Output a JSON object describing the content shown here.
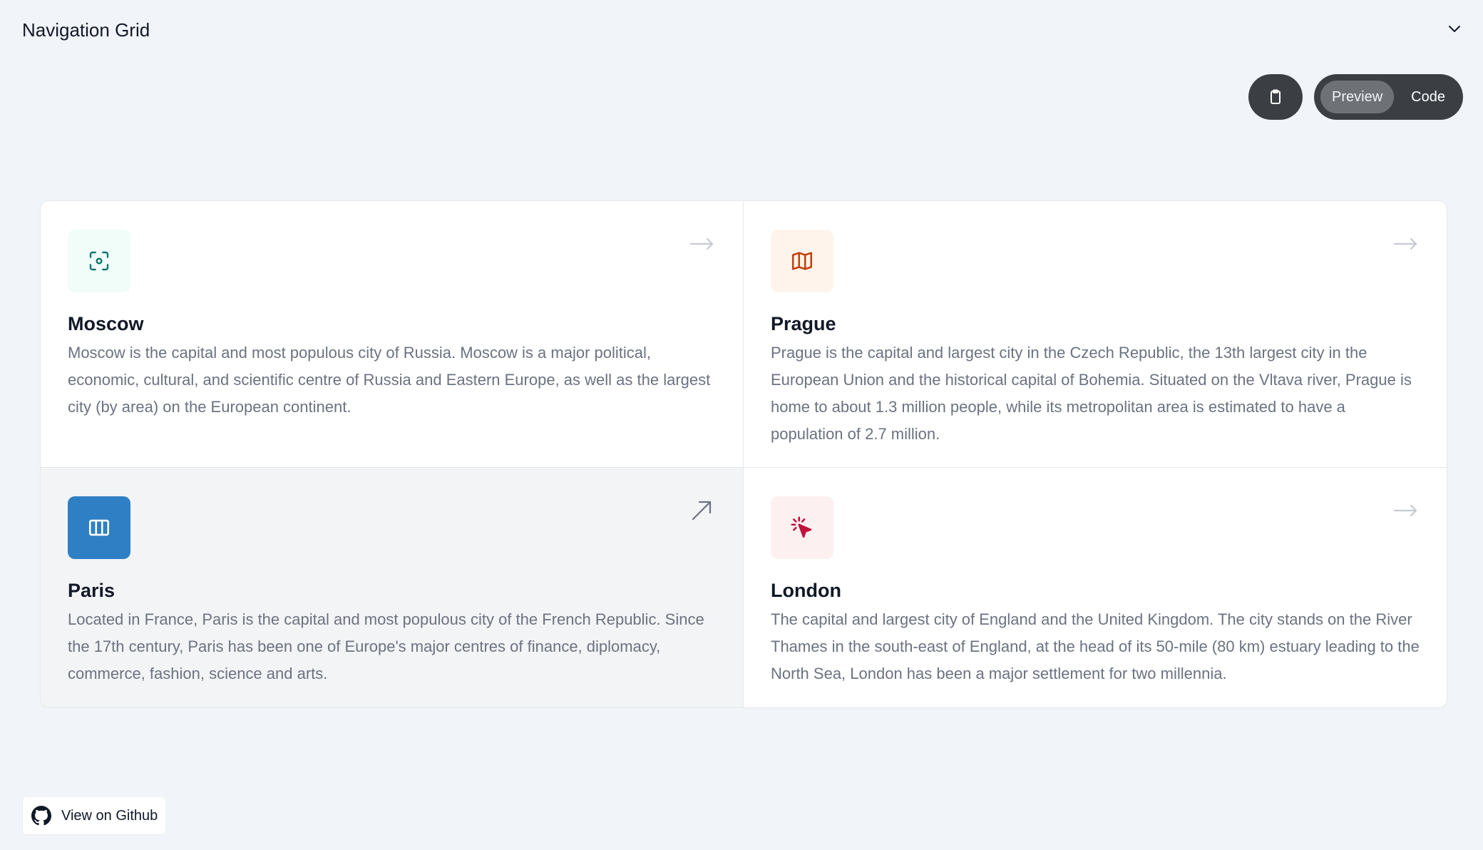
{
  "header": {
    "title": "Navigation Grid"
  },
  "toolbar": {
    "preview_label": "Preview",
    "code_label": "Code"
  },
  "cards": [
    {
      "title": "Moscow",
      "description": "Moscow is the capital and most populous city of Russia. Moscow is a major political, economic, cultural, and scientific centre of Russia and Eastern Europe, as well as the largest city (by area) on the European continent.",
      "icon": "scan-eye-icon",
      "icon_color": "#0f766e",
      "icon_bg": "#f0fdf9"
    },
    {
      "title": "Prague",
      "description": "Prague is the capital and largest city in the Czech Republic, the 13th largest city in the European Union and the historical capital of Bohemia. Situated on the Vltava river, Prague is home to about 1.3 million people, while its metropolitan area is estimated to have a population of 2.7 million.",
      "icon": "map-icon",
      "icon_color": "#c2410c",
      "icon_bg": "#fff4eb"
    },
    {
      "title": "Paris",
      "description": "Located in France, Paris is the capital and most populous city of the French Republic. Since the 17th century, Paris has been one of Europe's major centres of finance, diplomacy, commerce, fashion, science and arts.",
      "icon": "columns-icon",
      "icon_color": "#ffffff",
      "icon_bg": "#2f7fc5"
    },
    {
      "title": "London",
      "description": "The capital and largest city of England and the United Kingdom. The city stands on the River Thames in the south-east of England, at the head of its 50-mile (80 km) estuary leading to the North Sea, London has been a major settlement for two millennia.",
      "icon": "cursor-click-icon",
      "icon_color": "#be123c",
      "icon_bg": "#fdf0f1"
    }
  ],
  "footer": {
    "github_label": "View on Github"
  }
}
